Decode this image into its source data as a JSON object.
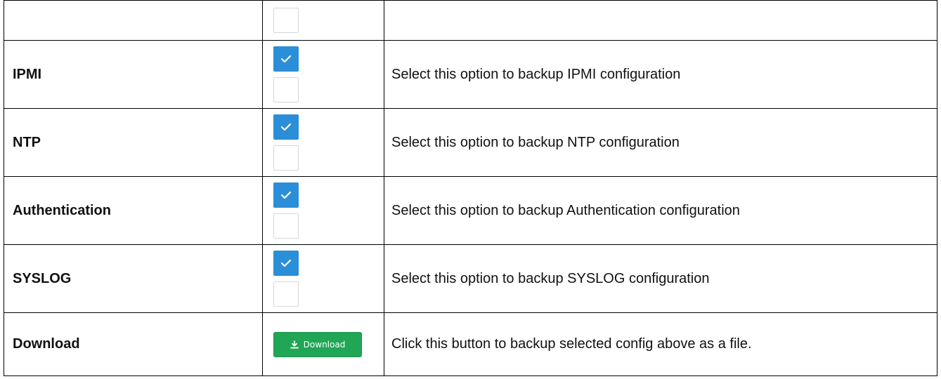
{
  "colors": {
    "checkbox_checked": "#2b8ed8",
    "checkbox_border": "#d6d6d6",
    "download_button": "#21a656"
  },
  "rows": [
    {
      "name": "IPMI",
      "checkbox_checked": true,
      "description": "Select this option to backup IPMI configuration"
    },
    {
      "name": "NTP",
      "checkbox_checked": true,
      "description": "Select this option to backup NTP configuration"
    },
    {
      "name": "Authentication",
      "checkbox_checked": true,
      "description": "Select this option to backup Authentication configuration"
    },
    {
      "name": "SYSLOG",
      "checkbox_checked": true,
      "description": "Select this option to backup SYSLOG configuration"
    }
  ],
  "download_row": {
    "name": "Download",
    "button_label": "Download",
    "button_icon": "download-icon",
    "description": "Click this button to backup selected config above as a file."
  }
}
